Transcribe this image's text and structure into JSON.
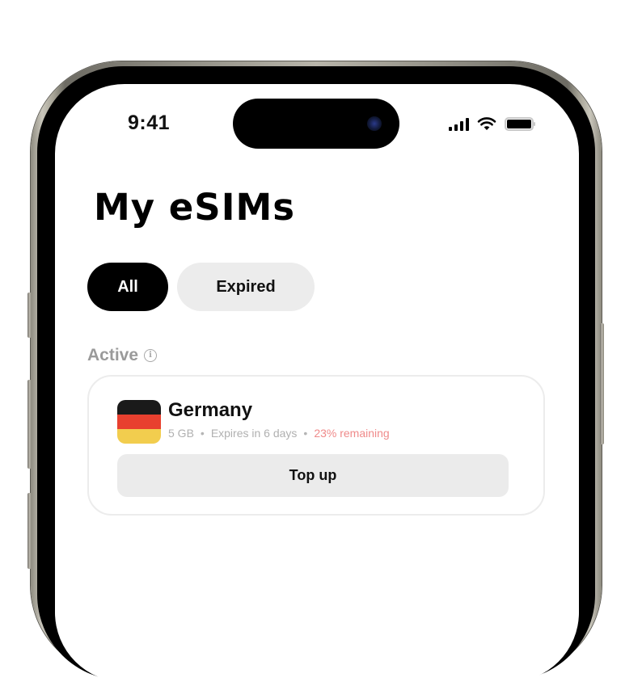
{
  "status_bar": {
    "time": "9:41",
    "icons": [
      "cellular-signal-icon",
      "wifi-icon",
      "battery-icon"
    ]
  },
  "header": {
    "title": "My eSIMs"
  },
  "filter_tabs": [
    {
      "label": "All",
      "selected": true
    },
    {
      "label": "Expired",
      "selected": false
    }
  ],
  "sections": {
    "active": {
      "label": "Active",
      "info_icon": "info-circle-icon",
      "esims": [
        {
          "country": "Germany",
          "flag_colors": [
            "#1a1a1a",
            "#e8402f",
            "#f2cd4e"
          ],
          "data_amount": "5 GB",
          "expiry": "Expires in 6 days",
          "remaining": "23% remaining",
          "remaining_color": "#ef8a8a",
          "action_label": "Top up"
        }
      ]
    }
  },
  "colors": {
    "active_tab_bg": "#000000",
    "inactive_tab_bg": "#ececec",
    "muted_text": "#9a9a9a"
  }
}
